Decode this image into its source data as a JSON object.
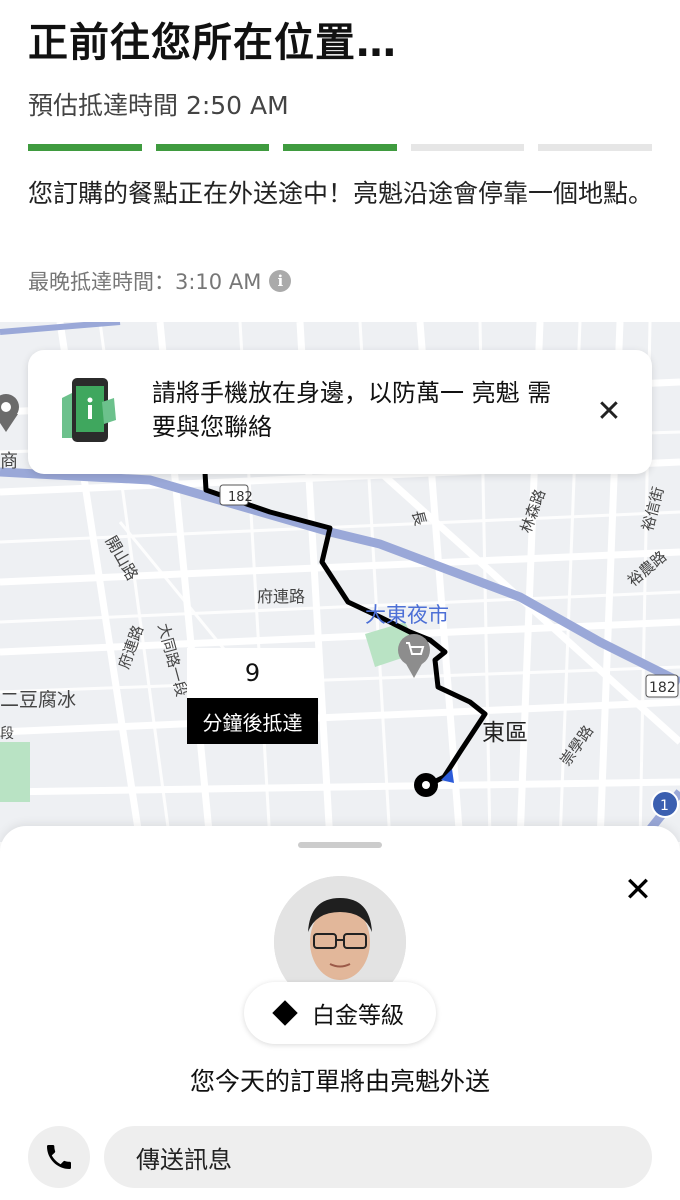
{
  "header": {
    "title": "正前往您所在位置…",
    "eta": "預估抵達時間 2:50 AM",
    "progress": {
      "segments_done": 3,
      "segments_total": 5
    },
    "message": "您訂購的餐點正在外送途中！亮魁沿途會停靠一個地點。",
    "latest_arrival": "最晚抵達時間：3:10 AM",
    "info_icon": "info-icon"
  },
  "banner": {
    "text": "請將手機放在身邊，以防萬一 亮魁 需要與您聯絡",
    "close_icon": "close-icon",
    "illustration": "phone-in-hand-icon"
  },
  "map": {
    "labels": {
      "night_market": "大東夜市",
      "district": "東區",
      "fulian_road": "府連路",
      "kaishan_road": "開山路",
      "datong_road": "大同路一段",
      "fulian_road_2": "府連路",
      "tofu": "二豆腐冰",
      "linsen_road": "林森路",
      "yulong_st": "裕農路",
      "yuxiang_st": "裕信街",
      "chongxue_road": "崇學路",
      "chang_road": "長",
      "shang": "商",
      "duan": "段",
      "shield_182_a": "182",
      "shield_182_b": "182",
      "shield_1": "1"
    },
    "colors": {
      "route": "#000000",
      "park": "#b9e3c4",
      "highway": "#9aa8d8",
      "road": "#ffffff"
    }
  },
  "eta_marker": {
    "minutes": "9",
    "label": "分鐘後抵達"
  },
  "sheet": {
    "close_icon": "close-icon",
    "tier_label": "白金等級",
    "driver_line": "您今天的訂單將由亮魁外送",
    "call_icon": "phone-icon",
    "message_button": "傳送訊息"
  }
}
